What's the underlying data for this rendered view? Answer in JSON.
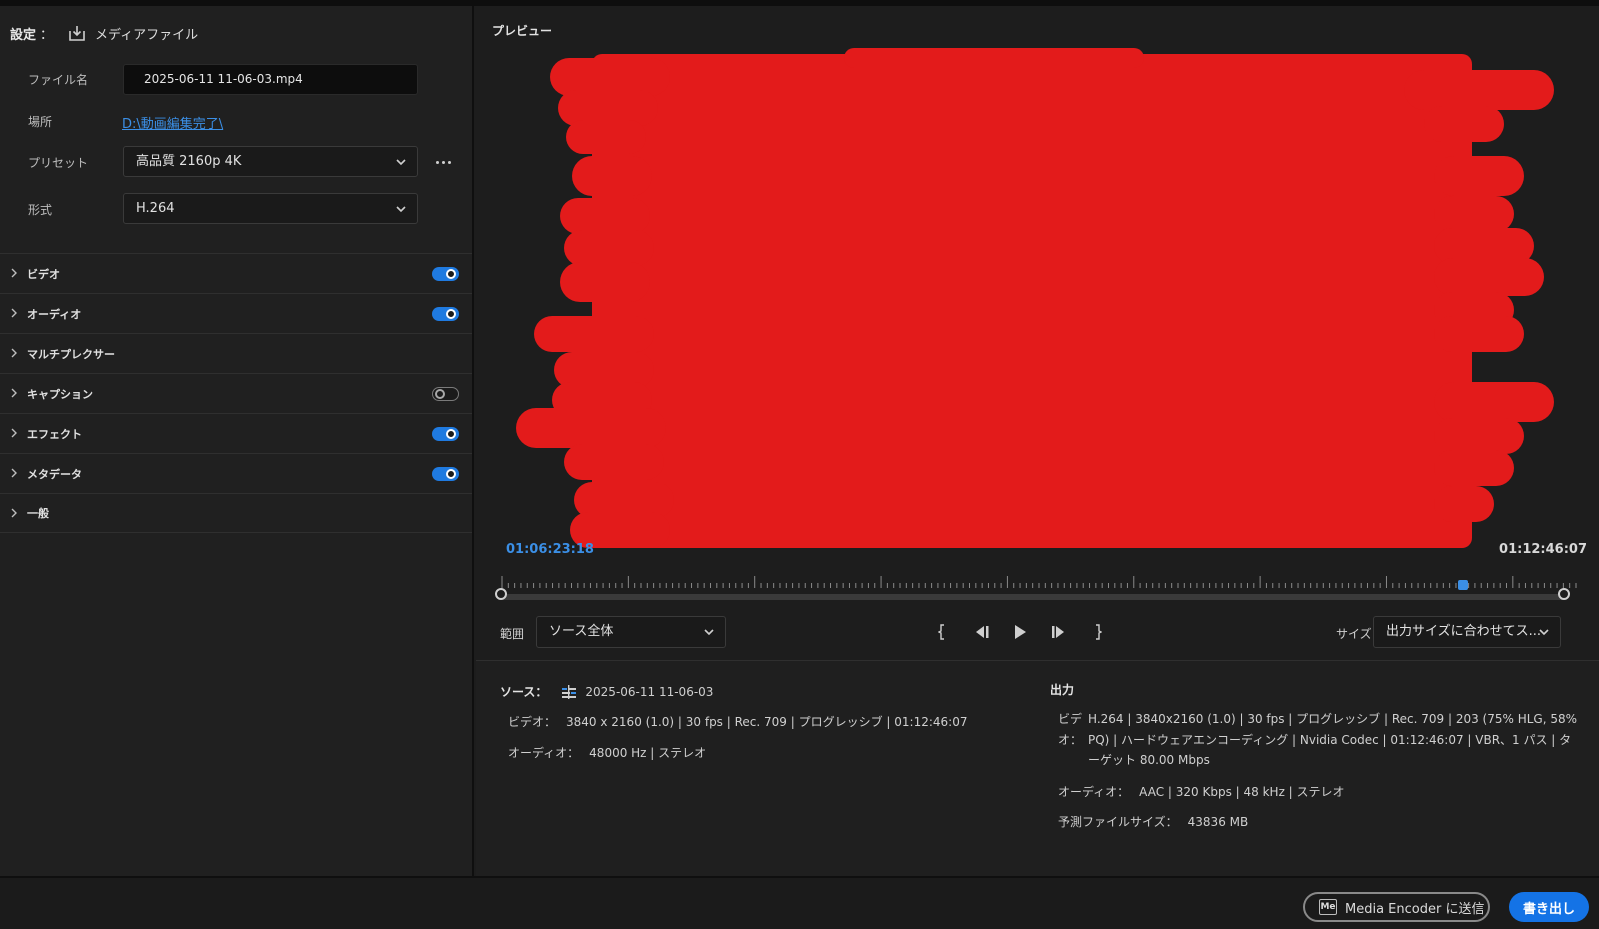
{
  "settings": {
    "title": "設定",
    "colon": "：",
    "media_label": "メディアファイル",
    "filename_label": "ファイル名",
    "filename_value": "2025-06-11 11-06-03.mp4",
    "location_label": "場所",
    "location_value": "D:\\動画編集完了\\",
    "preset_label": "プリセット",
    "preset_value": "高品質 2160p 4K",
    "format_label": "形式",
    "format_value": "H.264"
  },
  "sections": [
    {
      "label": "ビデオ",
      "toggle": "on"
    },
    {
      "label": "オーディオ",
      "toggle": "on"
    },
    {
      "label": "マルチプレクサー",
      "toggle": "none"
    },
    {
      "label": "キャプション",
      "toggle": "off"
    },
    {
      "label": "エフェクト",
      "toggle": "on"
    },
    {
      "label": "メタデータ",
      "toggle": "on"
    },
    {
      "label": "一般",
      "toggle": "none"
    }
  ],
  "preview": {
    "title": "プレビュー",
    "current_time": "01:06:23:18",
    "end_time": "01:12:46:07",
    "playhead_fraction": 0.904,
    "redaction_color": "#e31b1b"
  },
  "controls": {
    "range_label": "範囲",
    "range_value": "ソース全体",
    "size_label": "サイズ",
    "size_value": "出力サイズに合わせてス..."
  },
  "source": {
    "title": "ソース：",
    "file": "2025-06-11 11-06-03",
    "video_label": "ビデオ：",
    "video_value": "3840 x 2160 (1.0) | 30 fps | Rec. 709 | プログレッシブ | 01:12:46:07",
    "audio_label": "オーディオ：",
    "audio_value": "48000 Hz | ステレオ"
  },
  "output": {
    "title": "出力",
    "video_label": "ビデオ：",
    "video_value": "H.264 | 3840x2160 (1.0) | 30 fps | プログレッシブ | Rec. 709 | 203 (75% HLG, 58% PQ) | ハードウェアエンコーディング | Nvidia Codec | 01:12:46:07 | VBR、1 パス | ターゲット 80.00 Mbps",
    "audio_label": "オーディオ：",
    "audio_value": "AAC | 320 Kbps | 48 kHz | ステレオ",
    "filesize_label": "予測ファイルサイズ：",
    "filesize_value": "43836 MB"
  },
  "footer": {
    "me_icon": "Me",
    "send_label": "Media Encoder に送信",
    "export_label": "書き出し"
  },
  "colors": {
    "accent": "#1473e6",
    "link": "#3b8fe6",
    "background": "#1d1d1d"
  }
}
